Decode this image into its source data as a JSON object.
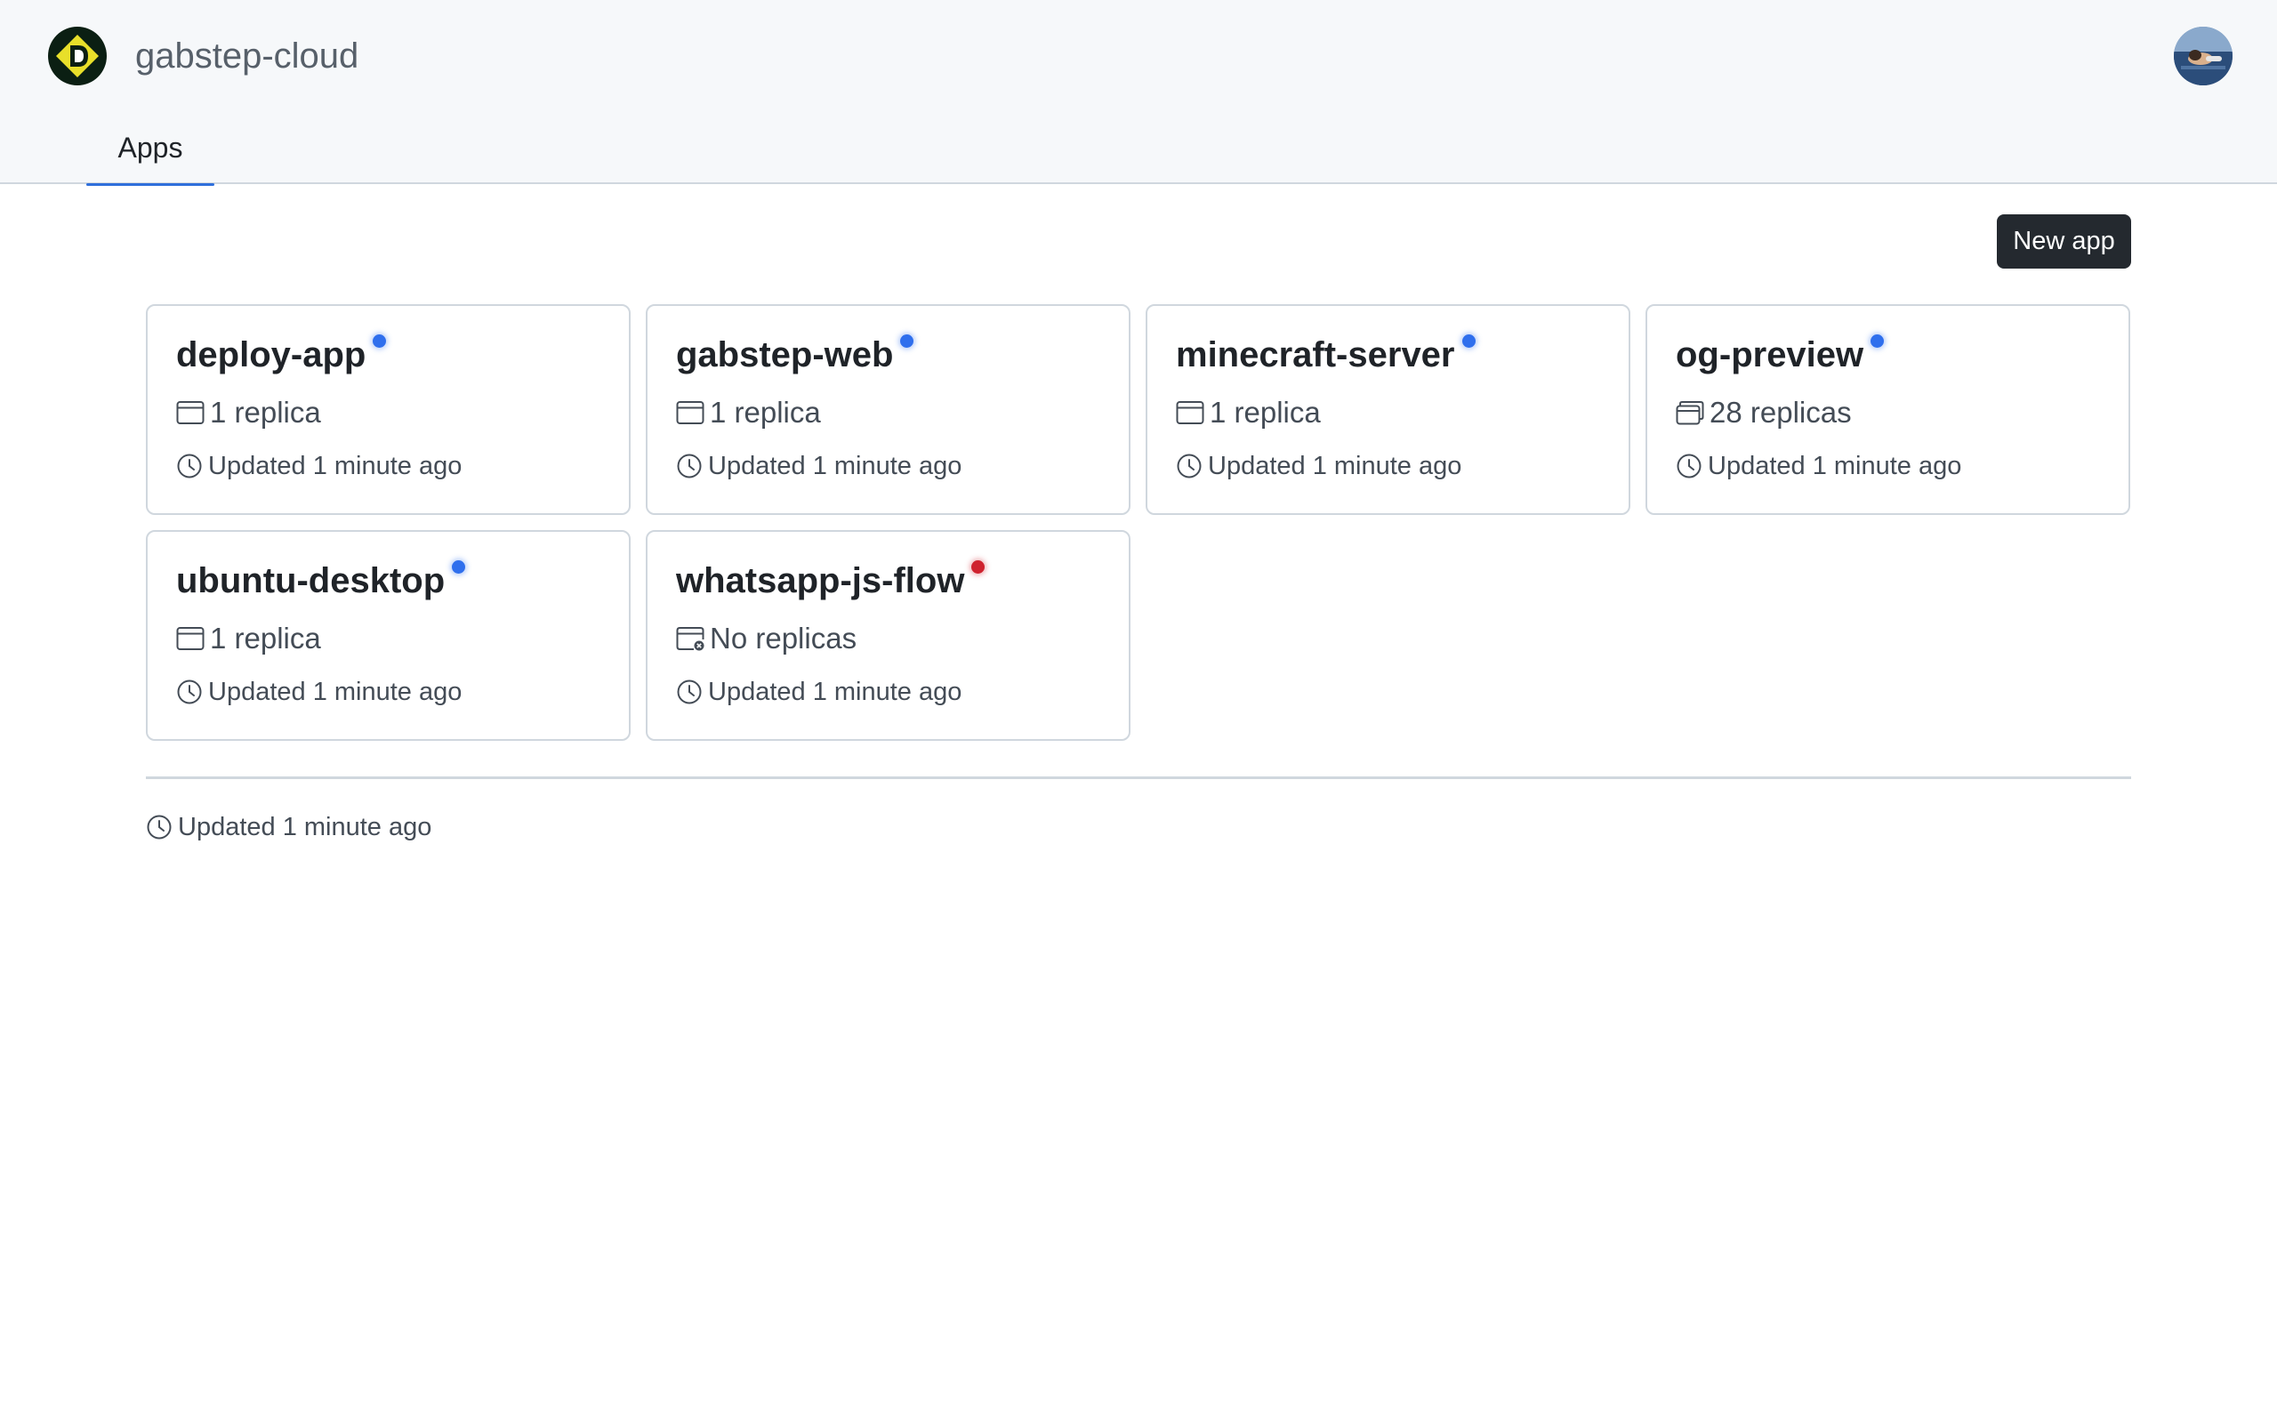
{
  "header": {
    "org_name": "gabstep-cloud",
    "logo_icon": "deploy-logo-icon",
    "avatar_icon": "user-avatar"
  },
  "tabs": [
    {
      "label": "Apps",
      "active": true
    }
  ],
  "toolbar": {
    "new_app_label": "New app"
  },
  "apps": [
    {
      "name": "deploy-app",
      "status": "running",
      "replicas": "1 replica",
      "replica_icon": "window-icon",
      "updated": "Updated 1 minute ago"
    },
    {
      "name": "gabstep-web",
      "status": "running",
      "replicas": "1 replica",
      "replica_icon": "window-icon",
      "updated": "Updated 1 minute ago"
    },
    {
      "name": "minecraft-server",
      "status": "running",
      "replicas": "1 replica",
      "replica_icon": "window-icon",
      "updated": "Updated 1 minute ago"
    },
    {
      "name": "og-preview",
      "status": "running",
      "replicas": "28 replicas",
      "replica_icon": "stacked-windows-icon",
      "updated": "Updated 1 minute ago"
    },
    {
      "name": "ubuntu-desktop",
      "status": "running",
      "replicas": "1 replica",
      "replica_icon": "window-icon",
      "updated": "Updated 1 minute ago"
    },
    {
      "name": "whatsapp-js-flow",
      "status": "error",
      "replicas": "No replicas",
      "replica_icon": "window-x-icon",
      "updated": "Updated 1 minute ago"
    }
  ],
  "footer": {
    "updated": "Updated 1 minute ago",
    "icon": "clock-icon"
  },
  "colors": {
    "running_dot": "#2f6fed",
    "error_dot": "#cf222e",
    "primary_button": "#24292f",
    "tab_underline": "#2f6fdb"
  }
}
